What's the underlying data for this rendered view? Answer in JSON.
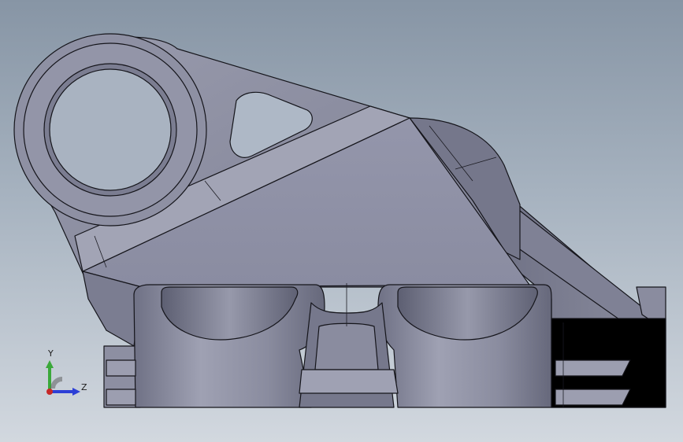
{
  "viewport": {
    "background_top": "#8795a5",
    "background_bottom": "#d2d8df"
  },
  "part": {
    "fill": "#8d8fa2",
    "shade": "#707286",
    "highlight": "#a4a6b6",
    "edge": "#15151b"
  },
  "triad": {
    "y_label": "Y",
    "z_label": "Z",
    "y_color": "#3aa83a",
    "z_color": "#2c3fd6",
    "x_color": "#c62828"
  }
}
